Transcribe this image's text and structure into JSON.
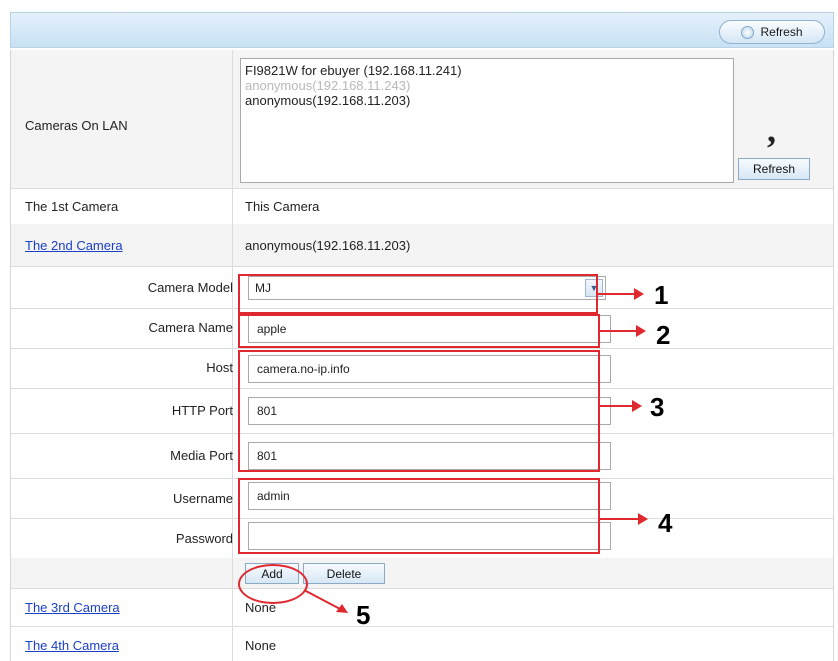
{
  "header": {
    "refresh_label": "Refresh"
  },
  "cameras_on_lan": {
    "label": "Cameras On LAN",
    "items": [
      "FI9821W for ebuyer (192.168.11.241)",
      "anonymous(192.168.11.243)",
      "anonymous(192.168.11.203)"
    ],
    "refresh_label": "Refresh",
    "comma_mark": ","
  },
  "first_camera": {
    "label": "The 1st Camera",
    "value": "This Camera"
  },
  "second_camera": {
    "label": "The 2nd Camera",
    "value": "anonymous(192.168.11.203)",
    "fields": {
      "model_label": "Camera Model",
      "model_value": "MJ",
      "name_label": "Camera Name",
      "name_value": "apple",
      "host_label": "Host",
      "host_value": "camera.no-ip.info",
      "http_port_label": "HTTP Port",
      "http_port_value": "801",
      "media_port_label": "Media Port",
      "media_port_value": "801",
      "username_label": "Username",
      "username_value": "admin",
      "password_label": "Password",
      "password_value": ""
    },
    "add_label": "Add",
    "delete_label": "Delete"
  },
  "third_camera": {
    "label": "The 3rd Camera",
    "value": "None"
  },
  "fourth_camera": {
    "label": "The 4th Camera",
    "value": "None"
  },
  "annotations": [
    "1",
    "2",
    "3",
    "4",
    "5"
  ],
  "colors": {
    "annotation_red": "#e0282f",
    "link_blue": "#1a3fc7",
    "header_blue": "#c8e1f4"
  }
}
